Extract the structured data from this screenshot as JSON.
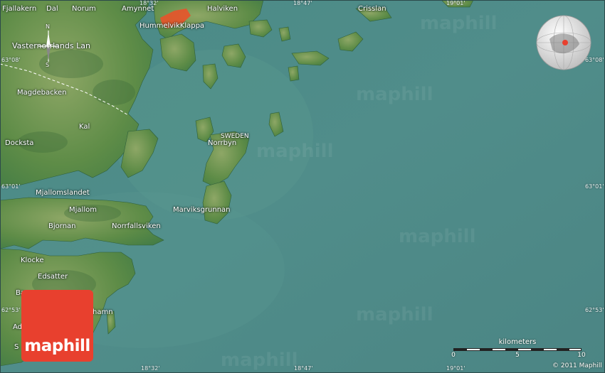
{
  "map": {
    "places": [
      {
        "name": "Fjallakern",
        "id": "fjallakern"
      },
      {
        "name": "Dal",
        "id": "dal"
      },
      {
        "name": "Norum",
        "id": "norum"
      },
      {
        "name": "Amynnet",
        "id": "amynnet"
      },
      {
        "name": "Halviken",
        "id": "halviken"
      },
      {
        "name": "Crisslan",
        "id": "crisslan"
      },
      {
        "name": "HummelvikKlappa",
        "id": "hummelvikklappa"
      },
      {
        "name": "Vasternorrlands Lan",
        "id": "vasternorrlands-lan"
      },
      {
        "name": "Magdebacken",
        "id": "magdebacken"
      },
      {
        "name": "Kal",
        "id": "kal"
      },
      {
        "name": "Docksta",
        "id": "docksta"
      },
      {
        "name": "SWEDEN",
        "id": "sweden"
      },
      {
        "name": "Norrbyn",
        "id": "norrbyn"
      },
      {
        "name": "Mjallomslandet",
        "id": "mjallomslandet"
      },
      {
        "name": "Mjallom",
        "id": "mjallom"
      },
      {
        "name": "Bjornan",
        "id": "bjornan"
      },
      {
        "name": "Norrfallsviken",
        "id": "norrfallsviken"
      },
      {
        "name": "Marviksgrunnan",
        "id": "marviksgrunnan"
      },
      {
        "name": "Klocke",
        "id": "klocke"
      },
      {
        "name": "Edsatter",
        "id": "edsatter"
      },
      {
        "name": "Ba",
        "id": "ba"
      },
      {
        "name": "hamn",
        "id": "hamn"
      },
      {
        "name": "Ad",
        "id": "ad"
      },
      {
        "name": "S",
        "id": "s"
      }
    ],
    "coordinates": {
      "top": [
        "18°32'",
        "18°47'",
        "19°01'"
      ],
      "bottom": [
        "18°32'",
        "18°47'",
        "19°01'"
      ],
      "left": [
        "63°08'",
        "63°01'",
        "62°53'"
      ],
      "right": [
        "63°08'",
        "63°01'",
        "62°53'"
      ]
    },
    "compass": {
      "north": "N",
      "south": "S"
    },
    "watermark": "maphill",
    "logo": "maphill",
    "scale": {
      "title": "kilometers",
      "ticks": [
        "0",
        "5",
        "10"
      ],
      "max_km": 10
    },
    "copyright": "© 2011 Maphill",
    "colors": {
      "water": "#4f8a88",
      "land": "#5f8f4a",
      "highlight": "#e8532a",
      "logo": "#e8402e"
    }
  }
}
